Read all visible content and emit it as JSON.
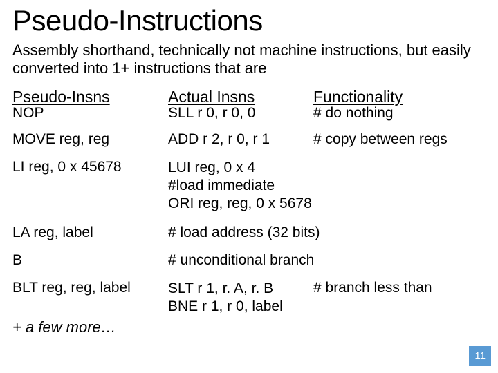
{
  "title": "Pseudo-Instructions",
  "subtitle": "Assembly shorthand, technically not machine instructions, but easily converted into 1+ instructions that are",
  "headers": {
    "col1": "Pseudo-Insns",
    "col2": "Actual Insns",
    "col3": "Functionality"
  },
  "rows": {
    "r0": {
      "pseudo": "NOP",
      "actual": "SLL r 0, r 0, 0",
      "func": "# do nothing"
    },
    "r1": {
      "pseudo": "MOVE reg, reg",
      "actual": "ADD r 2, r 0, r 1",
      "func": "# copy between regs"
    },
    "r2": {
      "pseudo": "LI reg, 0 x 45678",
      "actual_line1": "LUI reg, 0 x 4",
      "func_inline": "#load immediate",
      "actual_line2": "ORI reg, reg, 0 x 5678"
    },
    "r3": {
      "pseudo": "LA reg, label",
      "rest": "# load address (32 bits)"
    },
    "r4": {
      "pseudo": "B",
      "rest": "# unconditional branch"
    },
    "r5": {
      "pseudo": "BLT reg, reg, label",
      "actual_line1": "SLT r 1, r. A, r. B",
      "func_inline": "# branch less than",
      "actual_line2": "BNE r 1, r 0, label"
    }
  },
  "footer": "+ a few more…",
  "page_number": "11"
}
